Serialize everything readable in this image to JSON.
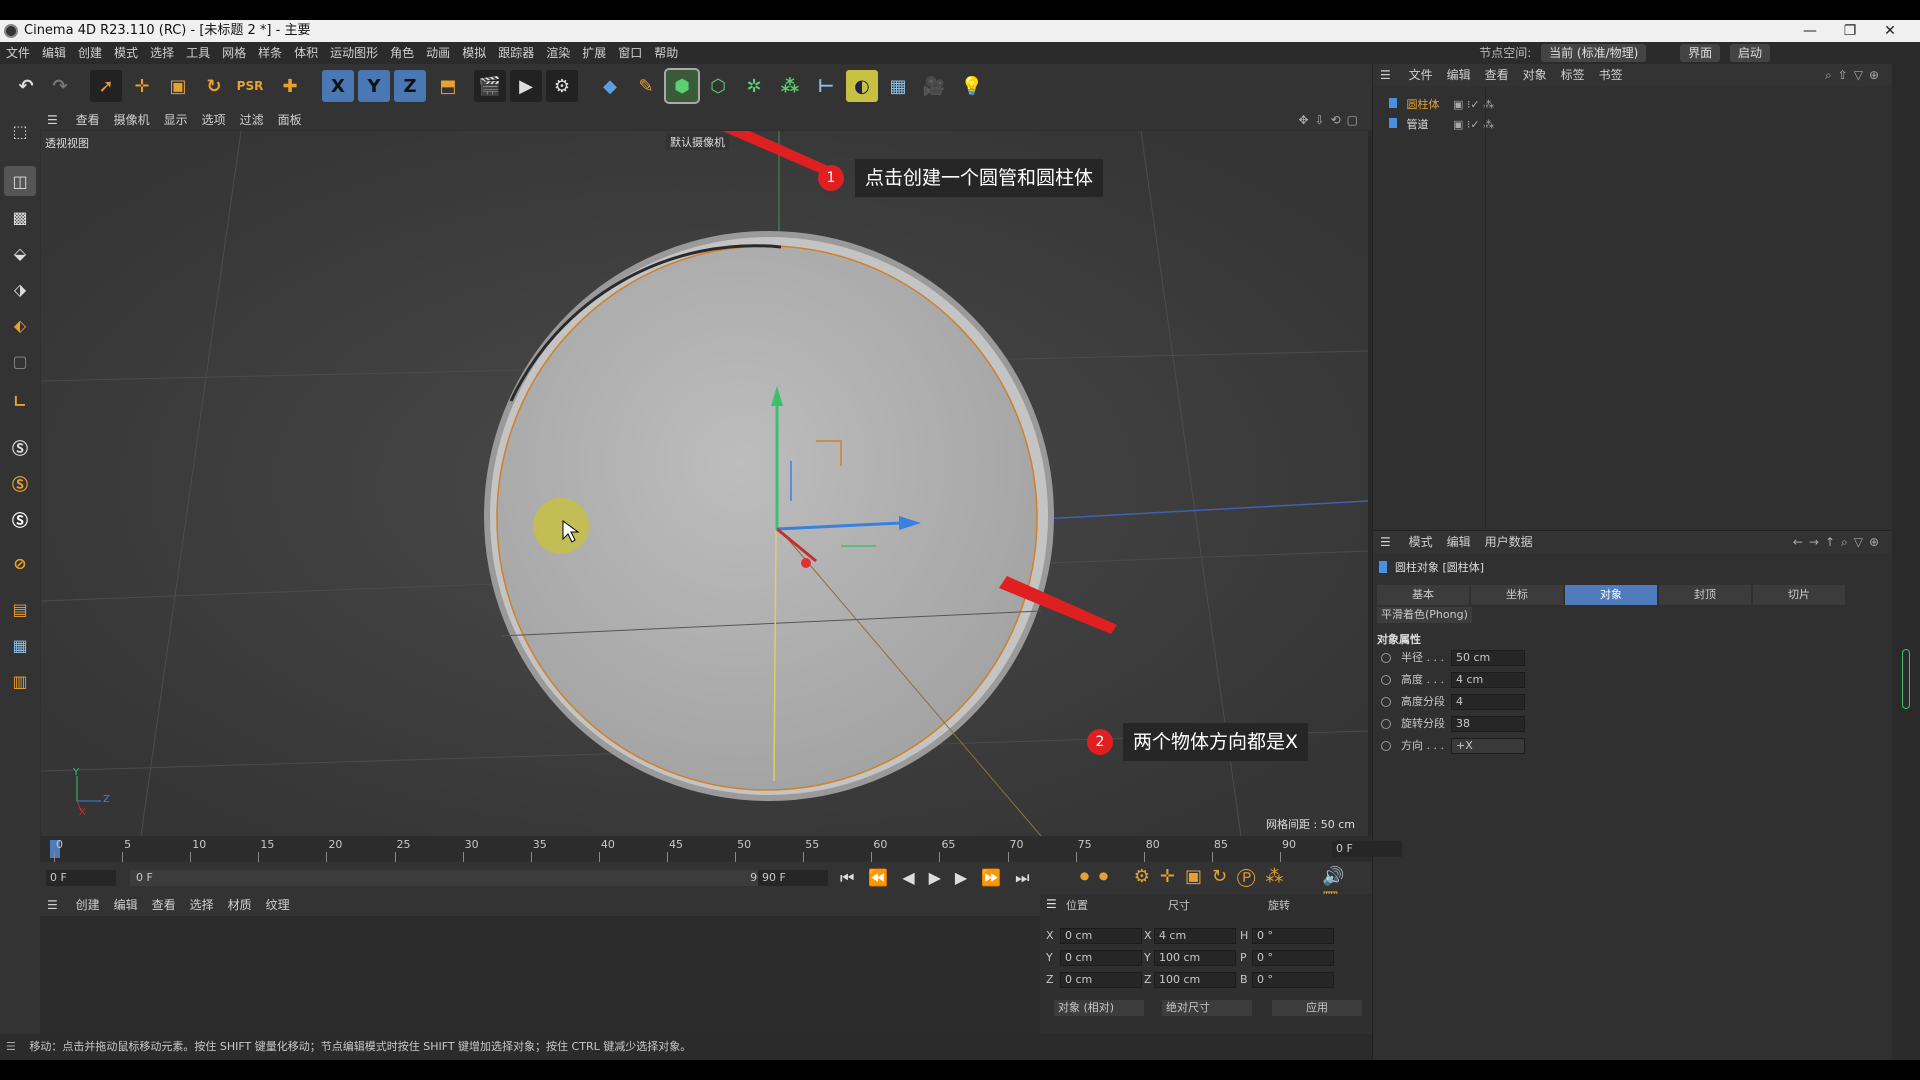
{
  "window": {
    "title": "Cinema 4D R23.110 (RC) - [未标题 2 *] - 主要"
  },
  "menu": [
    "文件",
    "编辑",
    "创建",
    "模式",
    "选择",
    "工具",
    "网格",
    "样条",
    "体积",
    "运动图形",
    "角色",
    "动画",
    "模拟",
    "跟踪器",
    "渲染",
    "扩展",
    "窗口",
    "帮助"
  ],
  "menu_right": {
    "label": "节点空间:",
    "value": "当前 (标准/物理)",
    "layout": "界面",
    "startup": "启动"
  },
  "toolbar_icons": [
    "undo-icon",
    "redo-icon",
    "select-icon",
    "move-icon",
    "scale-icon",
    "rotate-icon",
    "psr-icon",
    "add-icon",
    "x-axis-icon",
    "y-axis-icon",
    "z-axis-icon",
    "coord-icon",
    "render-region-icon",
    "render-view-icon",
    "render-settings-icon",
    "cube-icon",
    "pen-icon",
    "subdivision-icon",
    "extrude-icon",
    "cloner-icon",
    "array-icon",
    "effector-icon",
    "deformer-icon",
    "floor-icon",
    "camera-icon",
    "light-icon"
  ],
  "toolbar_axes": [
    "X",
    "Y",
    "Z"
  ],
  "viewport": {
    "menu": [
      "查看",
      "摄像机",
      "显示",
      "选项",
      "过滤",
      "面板"
    ],
    "label": "透视视图",
    "camera": "默认摄像机",
    "grid_spacing": "网格间距 : 50 cm",
    "axis_y": "Y",
    "axis_z": "Z",
    "axis_x": "X"
  },
  "annotations": [
    {
      "num": "1",
      "text": "点击创建一个圆管和圆柱体"
    },
    {
      "num": "2",
      "text": "两个物体方向都是X"
    }
  ],
  "object_manager": {
    "menu": [
      "文件",
      "编辑",
      "查看",
      "对象",
      "标签",
      "书签"
    ],
    "objects": [
      {
        "name": "圆柱体",
        "selected": true
      },
      {
        "name": "管道",
        "selected": false
      }
    ]
  },
  "attribute_manager": {
    "menu": [
      "模式",
      "编辑",
      "用户数据"
    ],
    "title": "圆柱对象 [圆柱体]",
    "tabs": [
      "基本",
      "坐标",
      "对象",
      "封顶",
      "切片"
    ],
    "active_tab": "对象",
    "phong": "平滑着色(Phong)",
    "section": "对象属性",
    "properties": [
      {
        "label": "半径 . . .",
        "value": "50 cm"
      },
      {
        "label": "高度 . . .",
        "value": "4 cm"
      },
      {
        "label": "高度分段",
        "value": "4"
      },
      {
        "label": "旋转分段",
        "value": "38"
      },
      {
        "label": "方向 . . .",
        "value": "+X"
      }
    ]
  },
  "timeline": {
    "ticks": [
      "0",
      "5",
      "10",
      "15",
      "20",
      "25",
      "30",
      "35",
      "40",
      "45",
      "50",
      "55",
      "60",
      "65",
      "70",
      "75",
      "80",
      "85",
      "90"
    ],
    "current_frame": "0 F",
    "start": "0 F",
    "range_start": "0 F",
    "range_end": "90 F",
    "end": "90 F"
  },
  "material_manager": {
    "menu": [
      "创建",
      "编辑",
      "查看",
      "选择",
      "材质",
      "纹理"
    ]
  },
  "coordinates": {
    "headers": [
      "位置",
      "尺寸",
      "旋转"
    ],
    "rows": [
      {
        "axis": "X",
        "pos": "0 cm",
        "size_axis": "X",
        "size": "4 cm",
        "rot_axis": "H",
        "rot": "0 °"
      },
      {
        "axis": "Y",
        "pos": "0 cm",
        "size_axis": "Y",
        "size": "100 cm",
        "rot_axis": "P",
        "rot": "0 °"
      },
      {
        "axis": "Z",
        "pos": "0 cm",
        "size_axis": "Z",
        "size": "100 cm",
        "rot_axis": "B",
        "rot": "0 °"
      }
    ],
    "mode": "对象 (相对)",
    "size_mode": "绝对尺寸",
    "apply": "应用"
  },
  "status": "移动：点击并拖动鼠标移动元素。按住 SHIFT 键量化移动；节点编辑模式时按住 SHIFT 键增加选择对象；按住 CTRL 键减少选择对象。",
  "colors": {
    "accent": "#4f7bbd",
    "annotation_red": "#e02020",
    "selection_orange": "#d0802a"
  }
}
